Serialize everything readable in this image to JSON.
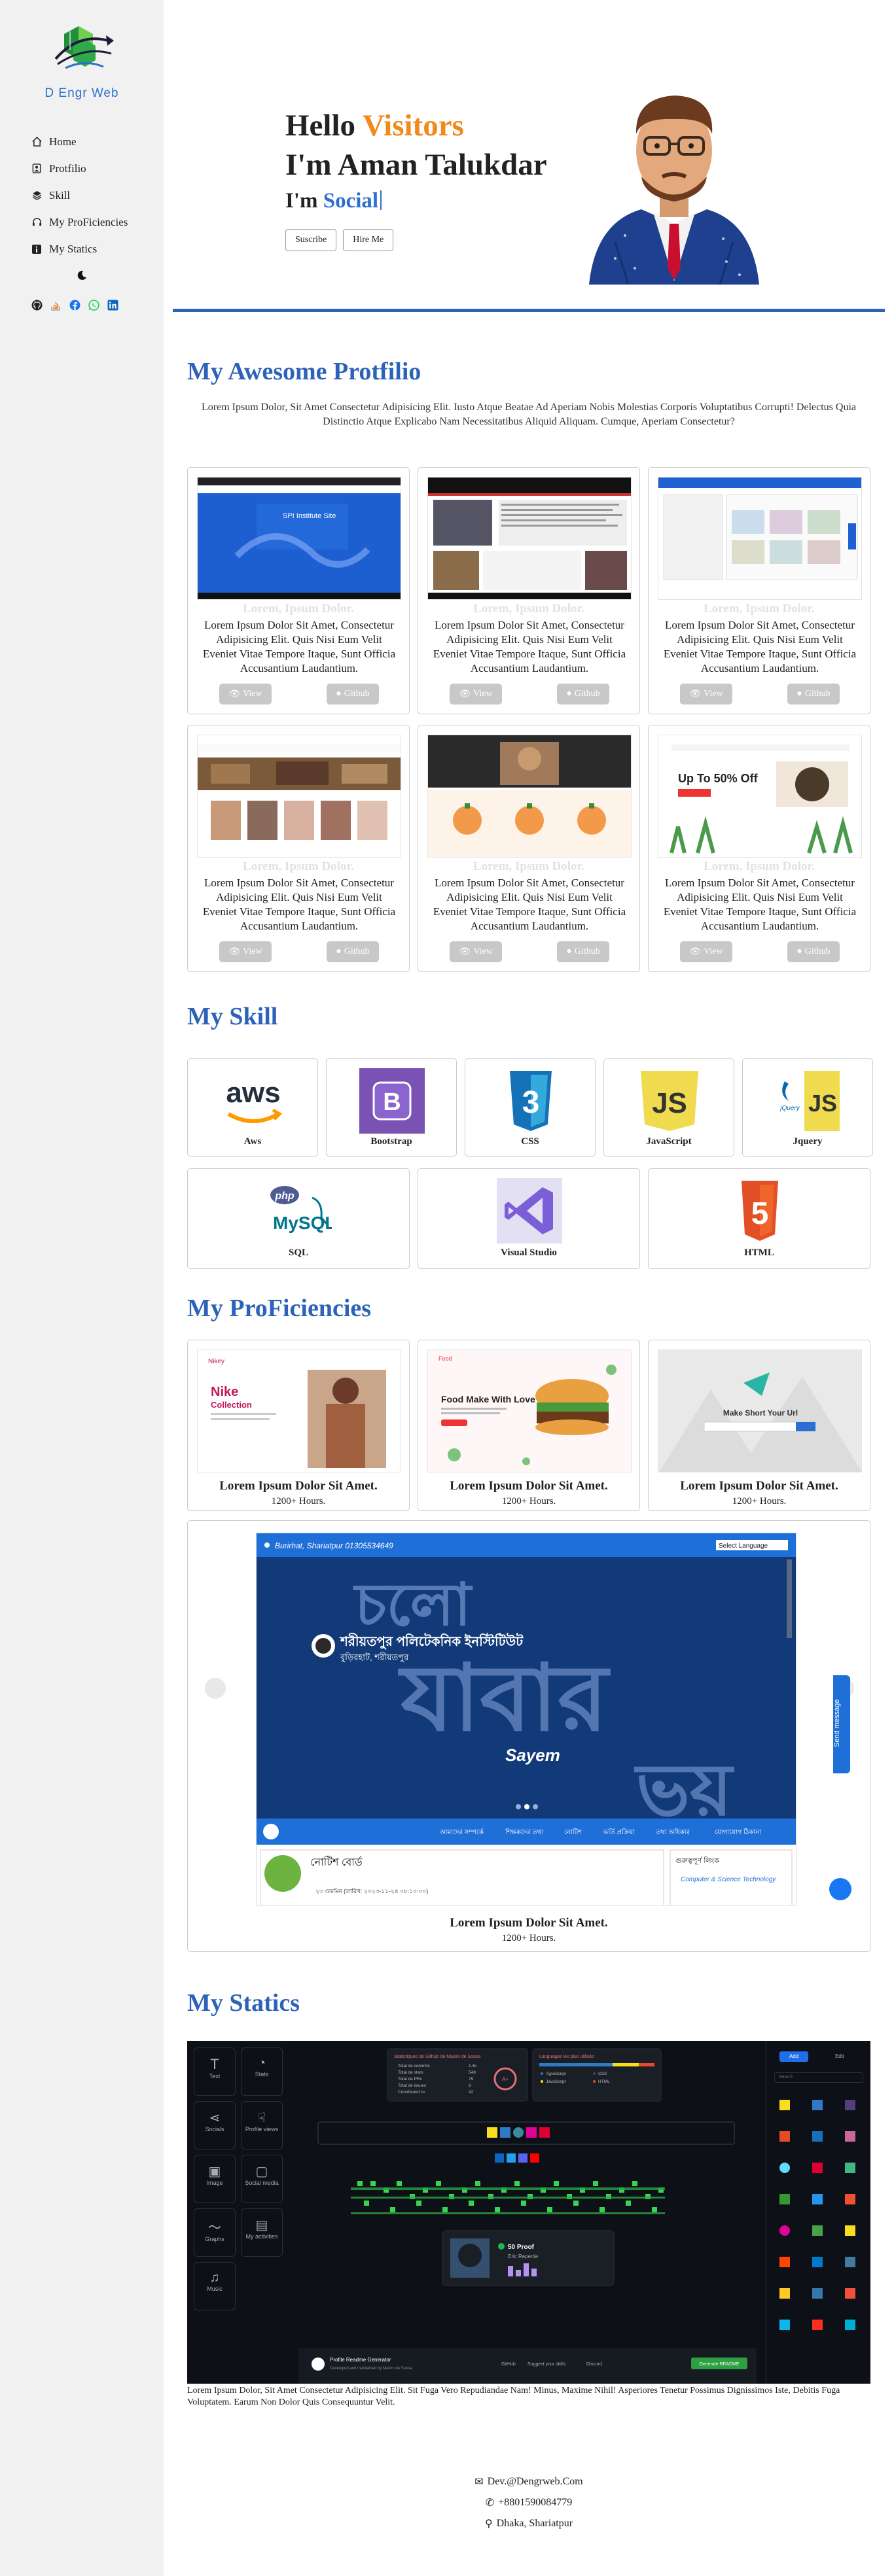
{
  "sidebar": {
    "logo_text": "D Engr Web",
    "items": [
      {
        "label": "Home",
        "icon": "home-icon"
      },
      {
        "label": "Protfilio",
        "icon": "user-icon"
      },
      {
        "label": "Skill",
        "icon": "layers-icon"
      },
      {
        "label": "My ProFiciencies",
        "icon": "headset-icon"
      },
      {
        "label": "My Statics",
        "icon": "info-icon"
      }
    ],
    "socials": [
      "github-icon",
      "stackoverflow-icon",
      "facebook-icon",
      "whatsapp-icon",
      "linkedin-icon"
    ]
  },
  "hero": {
    "hello": "Hello ",
    "hello_accent": "Visitors",
    "name": "I'm Aman Talukdar",
    "role_prefix": "I'm ",
    "role_accent": "Social",
    "subscribe": "Suscribe",
    "hire": "Hire Me"
  },
  "portfolio": {
    "title": "My Awesome Protfilio",
    "intro": "Lorem Ipsum Dolor, Sit Amet Consectetur Adipisicing Elit. Iusto Atque Beatae Ad Aperiam Nobis Molestias Corporis Voluptatibus Corrupti! Delectus Quia Distinctio Atque Explicabo Nam Necessitatibus Aliquid Aliquam. Cumque, Aperiam Consectetur?",
    "projects": [
      {
        "ghost": "Lorem, Ipsum Dolor.",
        "desc": "Lorem Ipsum Dolor Sit Amet, Consectetur Adipisicing Elit. Quis Nisi Eum Velit Eveniet Vitae Tempore Itaque, Sunt Officia Accusantium Laudantium.",
        "view": "View",
        "github": "Github"
      },
      {
        "ghost": "Lorem, Ipsum Dolor.",
        "desc": "Lorem Ipsum Dolor Sit Amet, Consectetur Adipisicing Elit. Quis Nisi Eum Velit Eveniet Vitae Tempore Itaque, Sunt Officia Accusantium Laudantium.",
        "view": "View",
        "github": "Github"
      },
      {
        "ghost": "Lorem, Ipsum Dolor.",
        "desc": "Lorem Ipsum Dolor Sit Amet, Consectetur Adipisicing Elit. Quis Nisi Eum Velit Eveniet Vitae Tempore Itaque, Sunt Officia Accusantium Laudantium.",
        "view": "View",
        "github": "Github"
      },
      {
        "ghost": "Lorem, Ipsum Dolor.",
        "desc": "Lorem Ipsum Dolor Sit Amet, Consectetur Adipisicing Elit. Quis Nisi Eum Velit Eveniet Vitae Tempore Itaque, Sunt Officia Accusantium Laudantium.",
        "view": "View",
        "github": "Github"
      },
      {
        "ghost": "Lorem, Ipsum Dolor.",
        "desc": "Lorem Ipsum Dolor Sit Amet, Consectetur Adipisicing Elit. Quis Nisi Eum Velit Eveniet Vitae Tempore Itaque, Sunt Officia Accusantium Laudantium.",
        "view": "View",
        "github": "Github"
      },
      {
        "ghost": "Lorem, Ipsum Dolor.",
        "desc": "Lorem Ipsum Dolor Sit Amet, Consectetur Adipisicing Elit. Quis Nisi Eum Velit Eveniet Vitae Tempore Itaque, Sunt Officia Accusantium Laudantium.",
        "view": "View",
        "github": "Github"
      }
    ]
  },
  "skills": {
    "title": "My Skill",
    "items": [
      "Aws",
      "Bootstrap",
      "CSS",
      "JavaScript",
      "Jquery",
      "SQL",
      "Visual Studio",
      "HTML"
    ],
    "logo_texts": {
      "aws": "aws",
      "bootstrap": "B",
      "css": "3",
      "js": "JS",
      "jquery": "JS",
      "jquery_small": "jQuery",
      "sql_php": "php",
      "sql_mysql": "MySQL",
      "html": "5"
    }
  },
  "proficiencies": {
    "title": "My ProFiciencies",
    "items": [
      {
        "title": "Lorem Ipsum Dolor Sit Amet.",
        "sub": "1200+ Hours."
      },
      {
        "title": "Lorem Ipsum Dolor Sit Amet.",
        "sub": "1200+ Hours."
      },
      {
        "title": "Lorem Ipsum Dolor Sit Amet.",
        "sub": "1200+ Hours."
      }
    ],
    "thumb_texts": {
      "nike_brand": "Nikey",
      "nike_title": "Nike",
      "nike_sub": "Collection",
      "food_brand": "Food",
      "food_title": "Food Make With Love",
      "url_title": "Make Short Your Url"
    },
    "big": {
      "title": "Lorem Ipsum Dolor Sit Amet.",
      "sub": "1200+ Hours.",
      "addr": "Burirhat, Shariatpur 01305534649",
      "lang": "Select Language",
      "word1": "চলো",
      "word2": "যাবার",
      "word3": "ভয়",
      "inst": "শরীয়তপুর পলিটেকনিক ইনস্টিটিউট",
      "inst_sub": "বুড়িরহাট, শরীয়তপুর",
      "name": "Sayem",
      "notice": "নোটিশ বোর্ড",
      "notice_item": "২৩ এডমিন (তারিখ: ২০২৩-১১-২৪ ০৮:১০:০০)",
      "side_title": "গুরুত্বপূর্ণ লিংক",
      "side_link": "Computer & Science Technology",
      "send": "Send message",
      "menu": [
        "আমাদের সম্পর্কে",
        "শিক্ষকদের তথ্য",
        "নোটিশ",
        "ভর্তি প্রক্রিয়া",
        "তথ্য অধিকার",
        "যোগাযোগ ঠিকানা"
      ]
    }
  },
  "statics": {
    "title": "My Statics",
    "tools": [
      "Text",
      "Stats",
      "Socials",
      "Profile views",
      "Image",
      "Social media",
      "Graphs",
      "My activities",
      "Music"
    ],
    "panel_title": "Statistiques de Github de Maxim de Sousa",
    "panel_rows": [
      {
        "label": "Total de commits",
        "value": "1.4k"
      },
      {
        "label": "Total de stars",
        "value": "548"
      },
      {
        "label": "Total de PRs",
        "value": "79"
      },
      {
        "label": "Total de issues",
        "value": "8"
      },
      {
        "label": "Contributed to",
        "value": "42"
      }
    ],
    "panel_grade": "A+",
    "lang_title": "Languages les plus utilisés",
    "langs": [
      "TypeScript",
      "CSS",
      "JavaScript",
      "HTML"
    ],
    "card_title": "50 Proof",
    "card_sub": "Eric Repertie",
    "footer_brand": "Profile Readme Generator",
    "footer_sub": "Developed and maintained by Maxim de Sousa",
    "footer_links": [
      "GitHub",
      "Suggest your skills",
      "Discord"
    ],
    "footer_btn": "Generate README",
    "tabs": [
      "Add",
      "Edit"
    ],
    "search": "Search"
  },
  "footer": {
    "text": "Lorem Ipsum Dolor, Sit Amet Consectetur Adipisicing Elit. Sit Fuga Vero Repudiandae Nam! Minus, Maxime Nihil! Asperiores Tenetur Possimus Dignissimos Iste, Debitis Fuga Voluptatem. Earum Non Dolor Quis Consequuntur Velit.",
    "email": "Dev.@Dengrweb.Com",
    "phone": "+8801590084779",
    "location": "Dhaka, Shariatpur"
  },
  "colors": {
    "accent": "#f08a1c",
    "brand_blue": "#2c63b9",
    "sidebar_bg": "#f1f1f1"
  }
}
